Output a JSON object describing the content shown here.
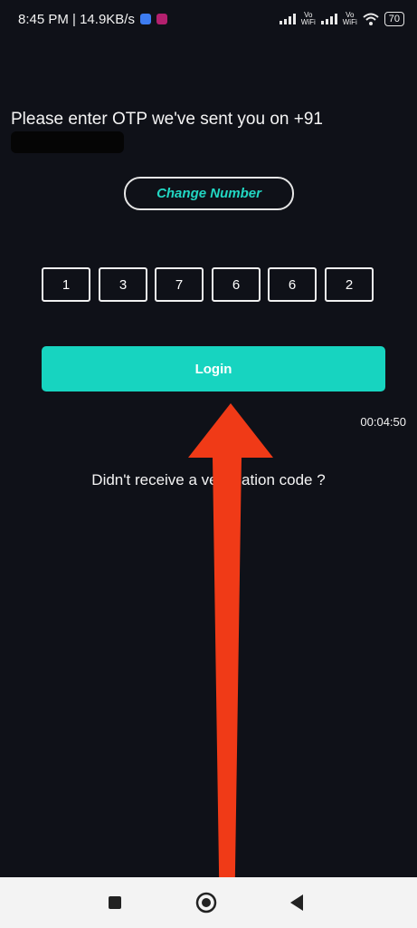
{
  "status": {
    "time_speed": "8:45 PM | 14.9KB/s",
    "vo_top": "Vo",
    "wifi_label": "WiFi",
    "battery": "70"
  },
  "otp": {
    "message": "Please enter OTP we've sent you on +91",
    "digits": [
      "1",
      "3",
      "7",
      "6",
      "6",
      "2"
    ]
  },
  "change_number_label": "Change Number",
  "login_label": "Login",
  "timer": "00:04:50",
  "resend_text": "Didn't receive a verification code ?",
  "colors": {
    "accent": "#17d4c0",
    "background": "#0f1118",
    "annotation_arrow": "#f03a17"
  },
  "icons": [
    "square-icon",
    "home-circle-icon",
    "back-triangle-icon",
    "wifi-icon",
    "signal-icon",
    "battery-icon"
  ]
}
